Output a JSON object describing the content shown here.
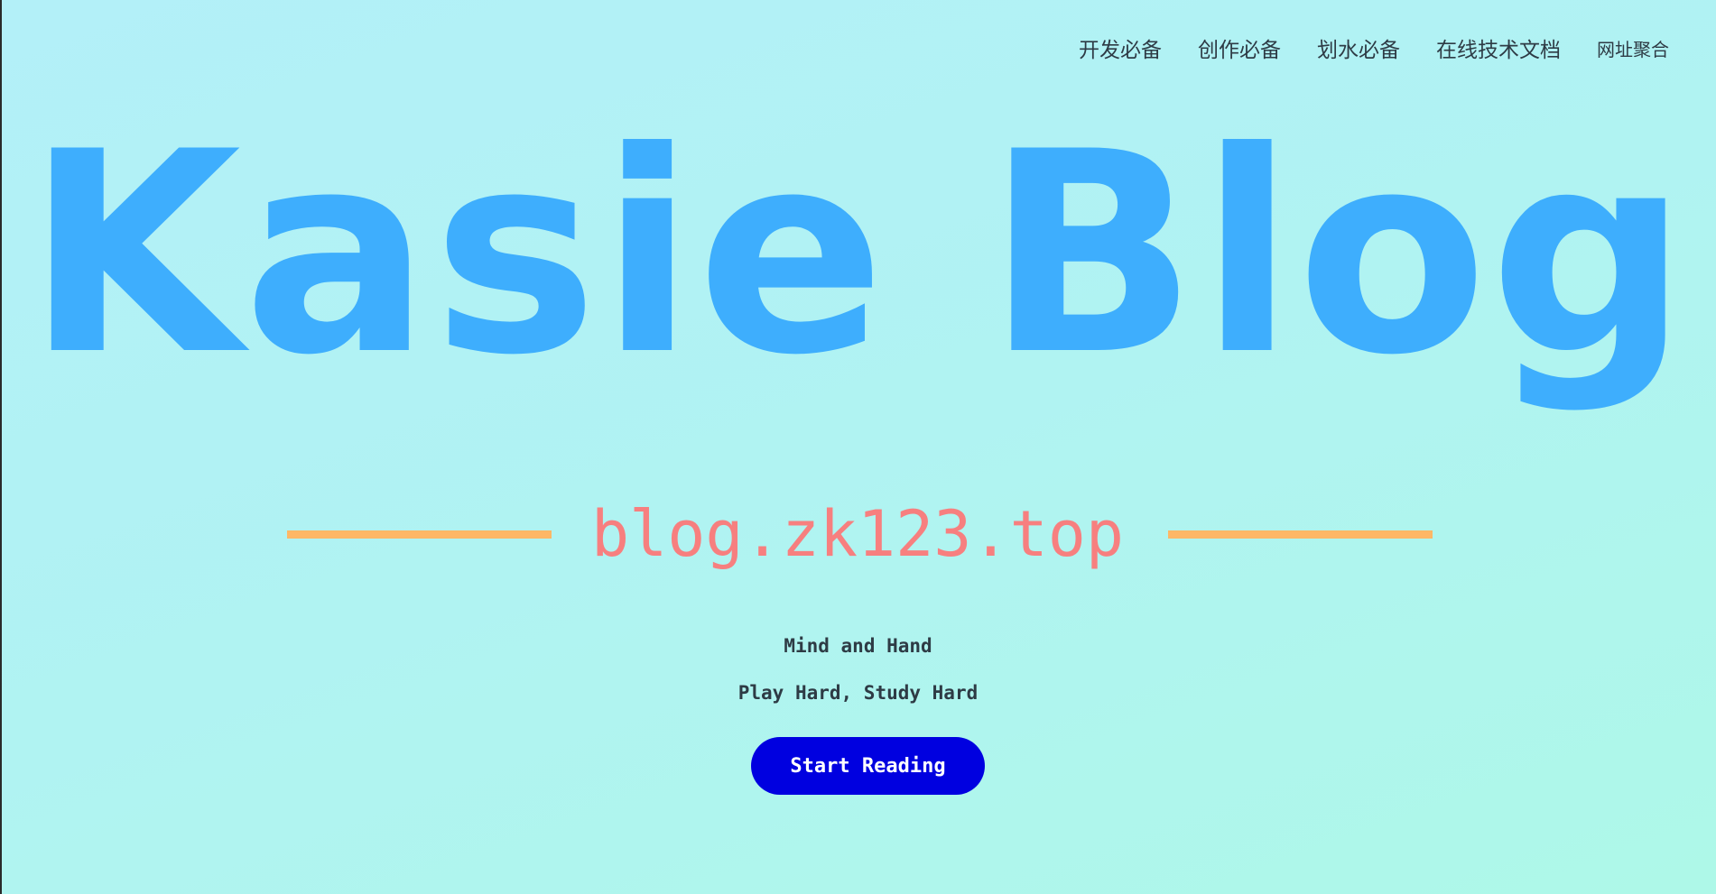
{
  "nav": {
    "items": [
      {
        "label": "开发必备"
      },
      {
        "label": "创作必备"
      },
      {
        "label": "划水必备"
      },
      {
        "label": "在线技术文档"
      },
      {
        "label": "网址聚合"
      }
    ]
  },
  "hero": {
    "title": "Kasie Blog",
    "subtitle": "blog.zk123.top",
    "mottos": [
      "Mind and Hand",
      "Play Hard, Study Hard"
    ],
    "cta_label": "Start Reading"
  },
  "colors": {
    "title": "#3eaefd",
    "subtitle": "#f77f7f",
    "rule": "#feb766",
    "cta_background": "#0000e0",
    "cta_text": "#ffffff",
    "nav_text": "#2e3b45"
  }
}
